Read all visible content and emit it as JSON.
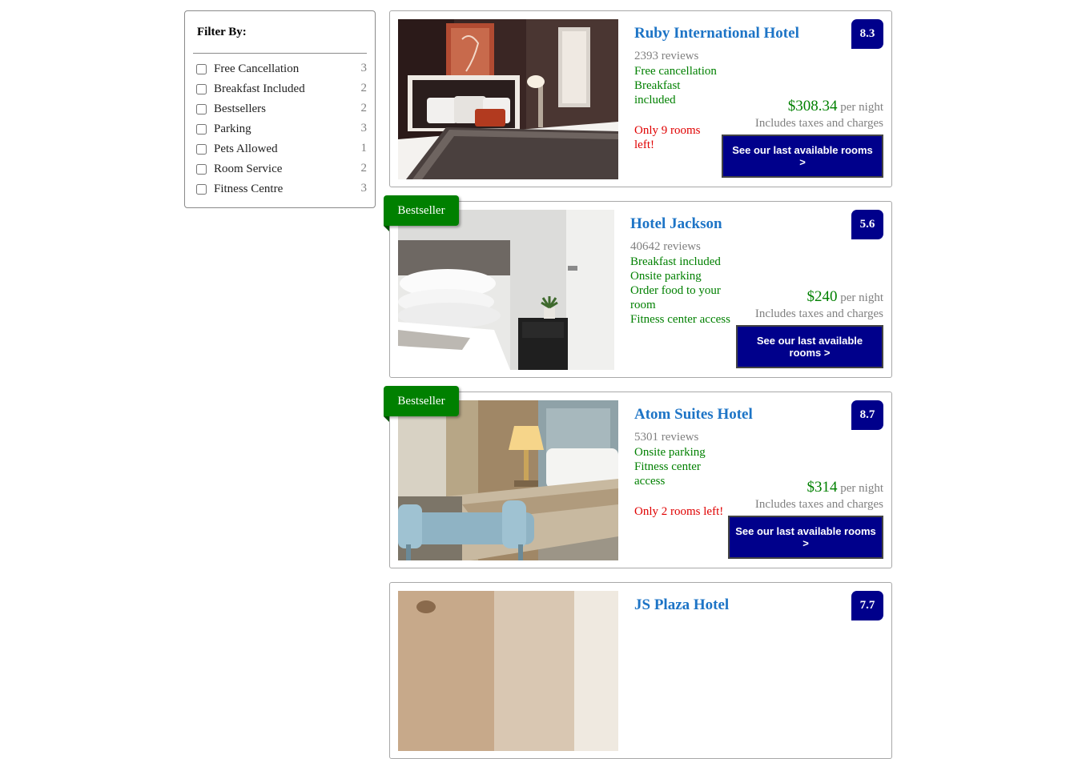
{
  "filters": {
    "title": "Filter By:",
    "items": [
      {
        "label": "Free Cancellation",
        "count": "3"
      },
      {
        "label": "Breakfast Included",
        "count": "2"
      },
      {
        "label": "Bestsellers",
        "count": "2"
      },
      {
        "label": "Parking",
        "count": "3"
      },
      {
        "label": "Pets Allowed",
        "count": "1"
      },
      {
        "label": "Room Service",
        "count": "2"
      },
      {
        "label": "Fitness Centre",
        "count": "3"
      }
    ]
  },
  "ribbon_label": "Bestseller",
  "hotels": [
    {
      "name": "Ruby International Hotel",
      "score": "8.3",
      "reviews": "2393 reviews",
      "features": [
        "Free cancellation",
        "Breakfast",
        "included"
      ],
      "scarcity": [
        "Only 9 rooms",
        "left!"
      ],
      "price": "$308.34",
      "per_night": "per night",
      "taxes": "Includes taxes and charges",
      "cta": "See our last available rooms >"
    },
    {
      "name": "Hotel Jackson",
      "score": "5.6",
      "reviews": "40642 reviews",
      "features": [
        "Breakfast included",
        "Onsite parking",
        "Order food to your",
        "room",
        "Fitness center access"
      ],
      "scarcity": [],
      "price": "$240",
      "per_night": "per night",
      "taxes": "Includes taxes and charges",
      "cta": "See our last available rooms >"
    },
    {
      "name": "Atom Suites Hotel",
      "score": "8.7",
      "reviews": "5301 reviews",
      "features": [
        "Onsite parking",
        "Fitness center",
        "access"
      ],
      "scarcity": [
        "Only 2 rooms left!"
      ],
      "price": "$314",
      "per_night": "per night",
      "taxes": "Includes taxes and charges",
      "cta": "See our last available rooms >"
    },
    {
      "name": "JS Plaza Hotel",
      "score": "7.7"
    }
  ],
  "colors": {
    "brand_blue": "#00008b",
    "link_blue": "#1d74c6",
    "feature_green": "#008000",
    "alert_red": "#e00000",
    "muted_gray": "#808080"
  }
}
